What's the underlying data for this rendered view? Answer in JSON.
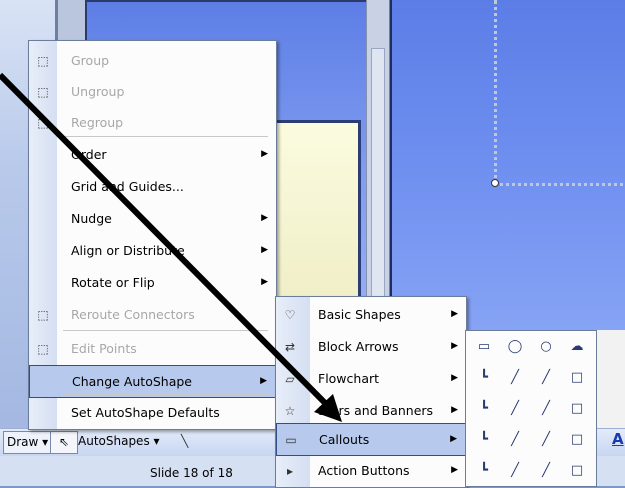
{
  "status_bar": {
    "slide_indicator": "Slide 18 of 18"
  },
  "drawing_toolbar": {
    "draw_label": "Draw ▾",
    "pointer_glyph": "⇖",
    "autoshapes_label": "AutoShapes ▾",
    "line_glyph": "╲",
    "font_color_glyph": "A"
  },
  "draw_menu": {
    "items": [
      {
        "label": "Group",
        "disabled": true,
        "submenu": false,
        "icon": "group-icon",
        "glyph": "⬚"
      },
      {
        "label": "Ungroup",
        "disabled": true,
        "submenu": false,
        "icon": "ungroup-icon",
        "glyph": "⬚"
      },
      {
        "label": "Regroup",
        "disabled": true,
        "submenu": false,
        "icon": "regroup-icon",
        "glyph": "⬚"
      },
      {
        "label": "Order",
        "disabled": false,
        "submenu": true,
        "icon": "",
        "glyph": ""
      },
      {
        "label": "Grid and Guides...",
        "disabled": false,
        "submenu": false,
        "icon": "",
        "glyph": ""
      },
      {
        "label": "Nudge",
        "disabled": false,
        "submenu": true,
        "icon": "",
        "glyph": ""
      },
      {
        "label": "Align or Distribute",
        "disabled": false,
        "submenu": true,
        "icon": "",
        "glyph": ""
      },
      {
        "label": "Rotate or Flip",
        "disabled": false,
        "submenu": true,
        "icon": "",
        "glyph": ""
      },
      {
        "label": "Reroute Connectors",
        "disabled": true,
        "submenu": false,
        "icon": "reroute-icon",
        "glyph": "⬚"
      },
      {
        "label": "Edit Points",
        "disabled": true,
        "submenu": false,
        "icon": "edit-points-icon",
        "glyph": "⬚"
      },
      {
        "label": "Change AutoShape",
        "disabled": false,
        "submenu": true,
        "icon": "",
        "glyph": "",
        "highlight": true
      },
      {
        "label": "Set AutoShape Defaults",
        "disabled": false,
        "submenu": false,
        "icon": "",
        "glyph": ""
      }
    ]
  },
  "change_autoshape_menu": {
    "items": [
      {
        "label": "Basic Shapes",
        "icon": "basic-shapes-icon",
        "glyph": "♡"
      },
      {
        "label": "Block Arrows",
        "icon": "block-arrows-icon",
        "glyph": "⇄"
      },
      {
        "label": "Flowchart",
        "icon": "flowchart-icon",
        "glyph": "▱"
      },
      {
        "label": "Stars and Banners",
        "icon": "stars-banners-icon",
        "glyph": "☆"
      },
      {
        "label": "Callouts",
        "icon": "callouts-icon",
        "glyph": "▭",
        "highlight": true
      },
      {
        "label": "Action Buttons",
        "icon": "action-buttons-icon",
        "glyph": "▸"
      }
    ],
    "submenu_arrow": "▶"
  },
  "callouts_palette": {
    "glyphs": [
      "▭",
      "◯",
      "○",
      "☁",
      "┗",
      "╱",
      "╱",
      "□",
      "┗",
      "╱",
      "╱",
      "□",
      "┗",
      "╱",
      "╱",
      "□",
      "┗",
      "╱",
      "╱",
      "□"
    ]
  },
  "colors": {
    "menu_highlight": "#b7c9ec",
    "disabled_text": "#a7a7a7",
    "slide_blue": "#5b7de6"
  }
}
